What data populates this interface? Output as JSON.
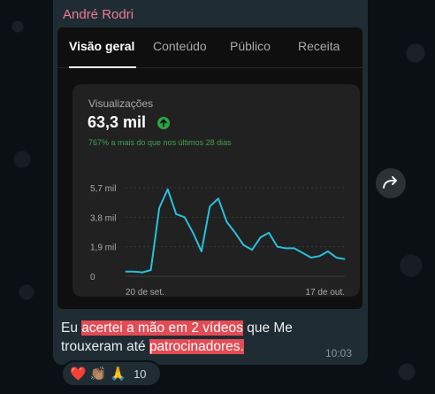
{
  "message": {
    "sender": "André Rodri",
    "text_parts": [
      {
        "text": "Eu ",
        "highlight": false
      },
      {
        "text": "acertei a mão em 2 vídeos",
        "highlight": true
      },
      {
        "text": " que Me trouxeram até ",
        "highlight": false
      },
      {
        "text": "patrocinadores.",
        "highlight": true
      }
    ],
    "time": "10:03"
  },
  "studio": {
    "tabs": [
      "Visão geral",
      "Conteúdo",
      "Público",
      "Receita"
    ],
    "active_tab": 0,
    "metric_label": "Visualizações",
    "metric_value": "63,3 mil",
    "metric_sub": "767% a mais do que nos últimos 28 dias"
  },
  "chart_data": {
    "type": "line",
    "y_ticks": [
      "5,7 mil",
      "3,8 mil",
      "1,9 mil",
      "0"
    ],
    "ylim": [
      0,
      5.7
    ],
    "x_labels": [
      "20 de set.",
      "17 de out."
    ],
    "line_color": "#27c1dc",
    "values": [
      0.3,
      0.3,
      0.25,
      0.4,
      4.4,
      5.6,
      4.0,
      3.8,
      2.8,
      1.6,
      4.5,
      5.0,
      3.5,
      2.8,
      2.0,
      1.7,
      2.5,
      2.8,
      1.9,
      1.8,
      1.8,
      1.5,
      1.2,
      1.3,
      1.6,
      1.2,
      1.1
    ]
  },
  "reactions": {
    "emojis": [
      "❤️",
      "👏🏽",
      "🙏"
    ],
    "count": "10"
  },
  "colors": {
    "sender": "#f07a93",
    "highlight": "#e34b55",
    "bubble": "#1f2c34",
    "positive": "#2ba640"
  },
  "icons": {
    "forward": "forward-arrow-icon",
    "trend": "arrow-up-circle-icon"
  }
}
